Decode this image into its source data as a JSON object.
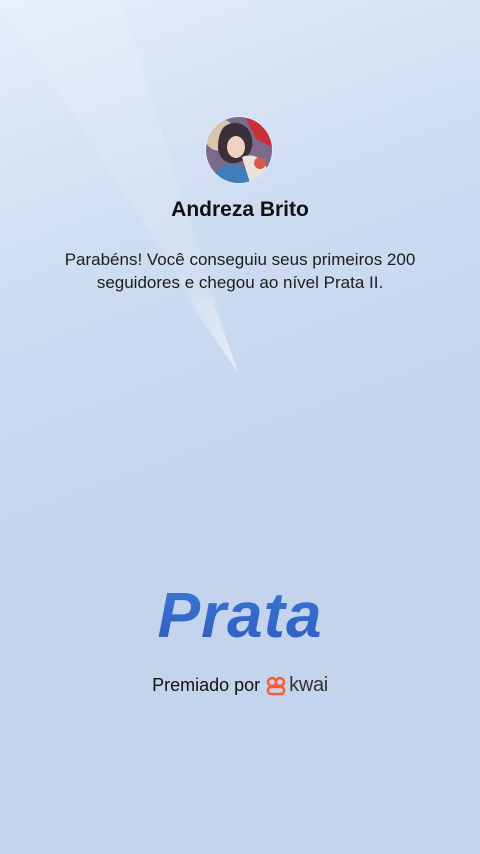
{
  "profile": {
    "name": "Andreza Brito",
    "avatar_icon": "avatar-illustration-icon"
  },
  "message": "Parabéns! Você conseguiu seus primeiros 200 seguidores e chegou ao nível Prata II.",
  "level": {
    "title": "Prata",
    "color": "#3f6fcc"
  },
  "award": {
    "label": "Premiado por",
    "brand_name": "kwai",
    "brand_color": "#ff5a2a",
    "brand_icon": "kwai-logo-icon"
  },
  "background": {
    "top_color": "#e6eefb",
    "bottom_color": "#c6d3ef"
  }
}
